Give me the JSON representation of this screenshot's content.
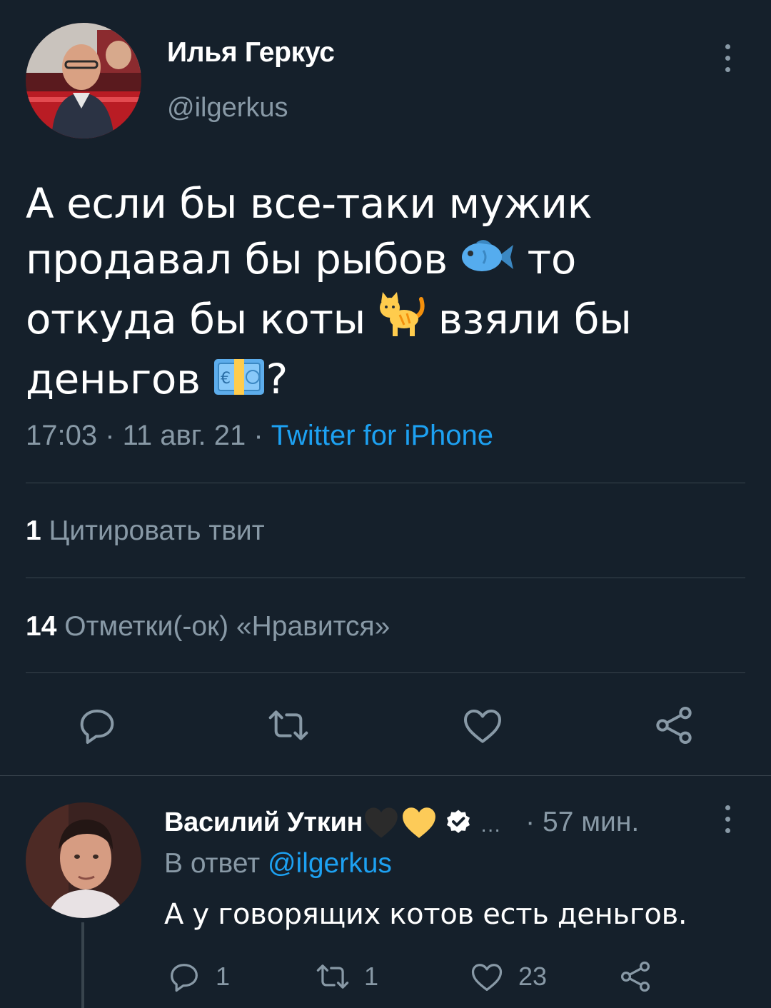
{
  "tweet": {
    "author_name": "Илья Геркус",
    "author_handle": "@ilgerkus",
    "avatar_icon": "author-avatar",
    "text_lines": [
      "А если бы все-таки мужик",
      "продавал бы  рыбов",
      "то",
      "откуда бы коты",
      "взяли бы",
      "деньгов",
      "?"
    ],
    "emojis": [
      "fish-emoji",
      "cat-emoji",
      "euro-banknote-emoji"
    ],
    "time": "17:03",
    "date": "11 авг. 21",
    "separator": " · ",
    "source": "Twitter for iPhone",
    "quote_count": "1",
    "quote_label": "Цитировать твит",
    "like_count": "14",
    "like_label": "Отметки(-ок) «Нравится»",
    "actions": [
      "reply-icon",
      "retweet-icon",
      "like-icon",
      "share-icon"
    ]
  },
  "reply": {
    "author_name": "Василий Уткин",
    "badges": [
      "black-heart-emoji",
      "yellow-heart-emoji",
      "verified-icon"
    ],
    "ellipsis": "…",
    "time_separator": "·",
    "time": "57 мин.",
    "reply_to_prefix": "В ответ",
    "reply_to_handle": "@ilgerkus",
    "text": "А у говорящих котов есть деньгов.",
    "reply_count": "1",
    "retweet_count": "1",
    "like_count": "23"
  },
  "colors": {
    "background": "#15202b",
    "divider": "#38444d",
    "secondary_text": "#8899a6",
    "accent": "#1da1f2"
  }
}
